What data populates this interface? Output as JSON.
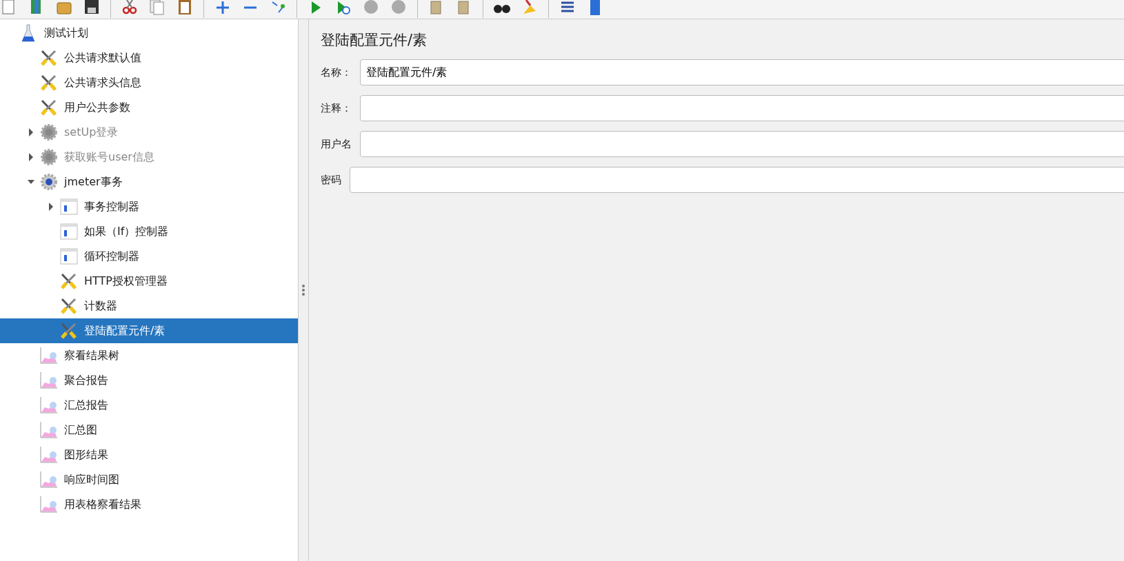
{
  "tree": [
    {
      "label": "测试计划",
      "kind": "plan",
      "selected": false,
      "children": [
        {
          "label": "公共请求默认值",
          "kind": "config",
          "selected": false
        },
        {
          "label": "公共请求头信息",
          "kind": "config",
          "selected": false
        },
        {
          "label": "用户公共参数",
          "kind": "config",
          "selected": false
        },
        {
          "label": "setUp登录",
          "kind": "thread-group",
          "selected": false,
          "disabled": true,
          "expanded": false
        },
        {
          "label": "获取账号user信息",
          "kind": "thread-group",
          "selected": false,
          "disabled": true,
          "expanded": false
        },
        {
          "label": "jmeter事务",
          "kind": "thread-group",
          "selected": false,
          "disabled": false,
          "expanded": true,
          "children": [
            {
              "label": "事务控制器",
              "kind": "controller",
              "selected": false,
              "expanded": false
            },
            {
              "label": "如果（If）控制器",
              "kind": "controller",
              "selected": false
            },
            {
              "label": "循环控制器",
              "kind": "controller",
              "selected": false
            },
            {
              "label": "HTTP授权管理器",
              "kind": "config",
              "selected": false
            },
            {
              "label": "计数器",
              "kind": "config",
              "selected": false
            },
            {
              "label": "登陆配置元件/素",
              "kind": "config",
              "selected": true
            }
          ]
        },
        {
          "label": "察看结果树",
          "kind": "listener",
          "selected": false
        },
        {
          "label": "聚合报告",
          "kind": "listener",
          "selected": false
        },
        {
          "label": "汇总报告",
          "kind": "listener",
          "selected": false
        },
        {
          "label": "汇总图",
          "kind": "listener",
          "selected": false
        },
        {
          "label": "图形结果",
          "kind": "listener",
          "selected": false
        },
        {
          "label": "响应时间图",
          "kind": "listener",
          "selected": false
        },
        {
          "label": "用表格察看结果",
          "kind": "listener",
          "selected": false
        }
      ]
    }
  ],
  "editor": {
    "title": "登陆配置元件/素",
    "fields": [
      {
        "label": "名称：",
        "value": "登陆配置元件/素"
      },
      {
        "label": "注释："
      },
      {
        "label": "用户名"
      },
      {
        "label": "密码"
      }
    ]
  }
}
